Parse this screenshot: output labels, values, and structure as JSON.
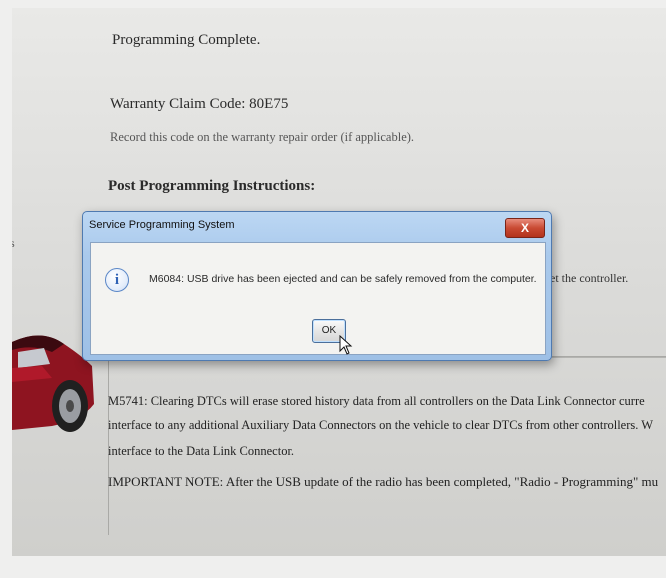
{
  "page": {
    "programming_complete": "Programming Complete.",
    "warranty_claim": "Warranty Claim Code: 80E75",
    "record_note": "Record this code on the warranty repair order (if applicable).",
    "post_instructions": "Post Programming Instructions:",
    "right_fragment": "et the controller.",
    "left_fragment": "s"
  },
  "dialog": {
    "title": "Service Programming System",
    "close_label": "X",
    "info_glyph": "i",
    "message": "M6084: USB drive has been ejected and can be safely removed from the computer.",
    "ok_label": "OK"
  },
  "lower_panel": {
    "line1": "M5741: Clearing DTCs will erase stored history data from all controllers on the Data Link Connector curre",
    "line2": "interface to any additional Auxiliary Data Connectors on the vehicle to clear DTCs from other controllers. W",
    "line3": "interface to the Data Link Connector.",
    "line4": "IMPORTANT NOTE: After the USB update of the radio has been completed, \"Radio - Programming\" mu"
  },
  "icons": {
    "info": "info-icon",
    "close": "close-icon",
    "cursor": "mouse-pointer-icon",
    "car": "car-image"
  },
  "colors": {
    "dialog_frame": "#a9c9ec",
    "close_button": "#c94a33",
    "info_icon": "#2f62b5",
    "car_body": "#8e1420"
  }
}
